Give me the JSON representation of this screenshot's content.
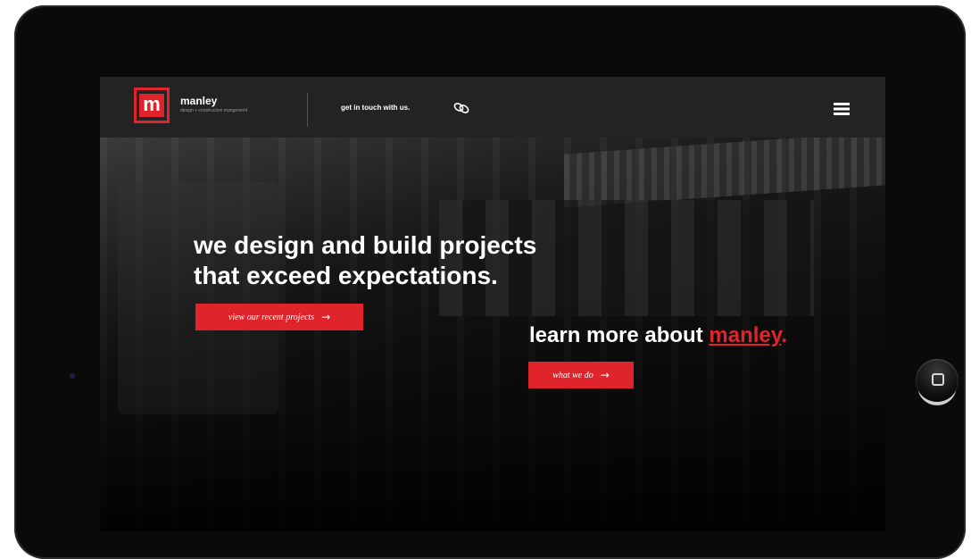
{
  "brand": {
    "logo_letter": "m",
    "name": "manley",
    "tagline": "design + construction mangement"
  },
  "nav": {
    "contact_label": "get in touch with us.",
    "contact_icon": "link-icon",
    "menu_icon": "hamburger-menu-icon"
  },
  "hero": {
    "headline_line1": "we design and build projects",
    "headline_line2": "that exceed expectations.",
    "projects_button": "view our recent projects",
    "learn_prefix": "learn more about ",
    "learn_accent": "manley",
    "learn_suffix": ".",
    "whatwedo_button": "what we do",
    "arrow": "→"
  },
  "colors": {
    "accent": "#e0242b",
    "navbar": "#232323",
    "bezel": "#0a0a0a"
  }
}
